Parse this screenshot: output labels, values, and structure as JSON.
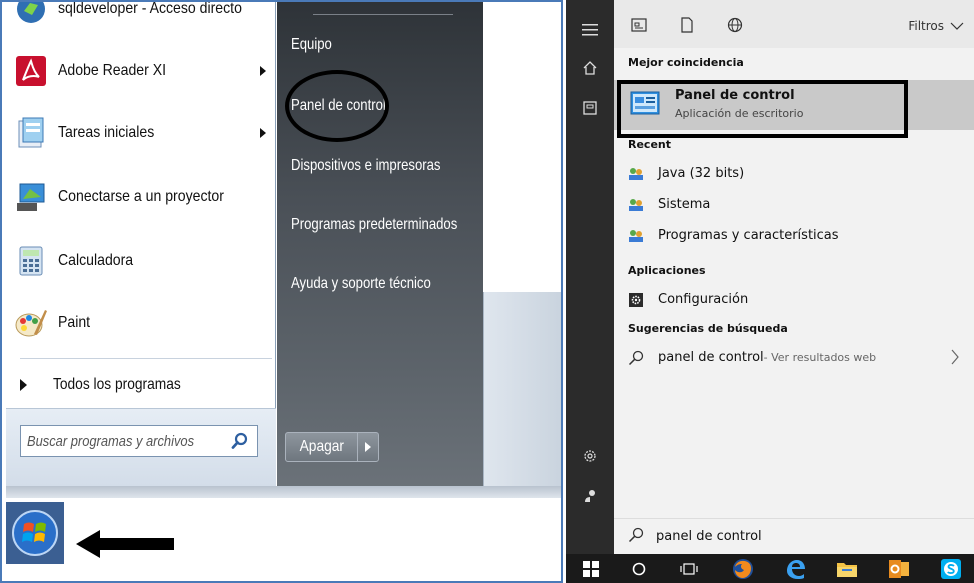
{
  "win7": {
    "programs": [
      {
        "label": "sqldeveloper - Acceso directo",
        "icon": "sqldeveloper-icon",
        "has_submenu": false
      },
      {
        "label": "Adobe Reader XI",
        "icon": "adobe-reader-icon",
        "has_submenu": true
      },
      {
        "label": "Tareas iniciales",
        "icon": "tareas-iniciales-icon",
        "has_submenu": true
      },
      {
        "label": "Conectarse a un proyector",
        "icon": "projector-icon",
        "has_submenu": false
      },
      {
        "label": "Calculadora",
        "icon": "calculator-icon",
        "has_submenu": false
      },
      {
        "label": "Paint",
        "icon": "paint-icon",
        "has_submenu": false
      }
    ],
    "all_programs": "Todos los programas",
    "search_placeholder": "Buscar programas y archivos",
    "right_links": [
      "Equipo",
      "Panel de control",
      "Dispositivos e impresoras",
      "Programas predeterminados",
      "Ayuda y soporte técnico"
    ],
    "shutdown_label": "Apagar"
  },
  "win10": {
    "filters_label": "Filtros",
    "best_match_header": "Mejor coincidencia",
    "best_match": {
      "title": "Panel de control",
      "subtitle": "Aplicación de escritorio"
    },
    "recent_header": "Recent",
    "recent": [
      "Java (32 bits)",
      "Sistema",
      "Programas y características"
    ],
    "apps_header": "Aplicaciones",
    "apps": [
      "Configuración"
    ],
    "suggestions_header": "Sugerencias de búsqueda",
    "suggestion": {
      "query": "panel de control",
      "suffix": " - Ver resultados web"
    },
    "search_text": "panel de control"
  }
}
